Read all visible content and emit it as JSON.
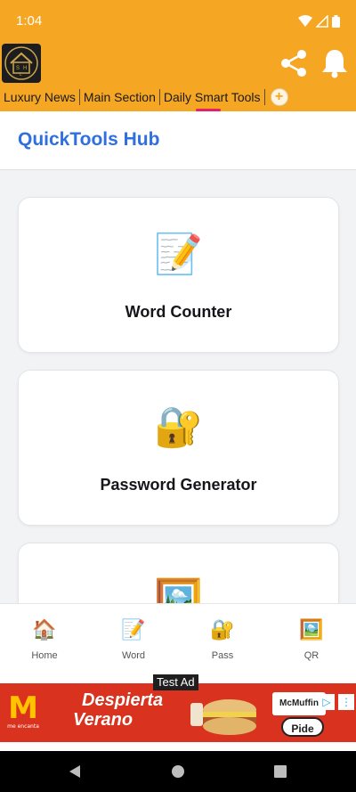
{
  "status_bar": {
    "time": "1:04"
  },
  "header": {
    "logo_icon": "house-logo-icon",
    "logo_letters": [
      "S",
      "H",
      "L"
    ],
    "tabs": [
      {
        "label": "Luxury News"
      },
      {
        "label": "Main Section"
      },
      {
        "label": "Daily Smart Tools"
      }
    ],
    "add_tab_icon": "plus-circle-icon",
    "accent_color": "#f5a623",
    "active_tab_indicator_color": "#e91e63"
  },
  "page": {
    "title": "QuickTools Hub",
    "title_color": "#2f6fdf"
  },
  "cards": [
    {
      "icon": "memo-icon",
      "emoji": "📝",
      "label": "Word Counter"
    },
    {
      "icon": "locked-with-key-icon",
      "emoji": "🔐",
      "label": "Password Generator"
    },
    {
      "icon": "framed-picture-icon",
      "emoji": "🖼️",
      "label": ""
    }
  ],
  "bottom_nav": [
    {
      "icon": "house-icon",
      "emoji": "🏠",
      "label": "Home"
    },
    {
      "icon": "memo-icon",
      "emoji": "📝",
      "label": "Word"
    },
    {
      "icon": "locked-with-key-icon",
      "emoji": "🔐",
      "label": "Pass"
    },
    {
      "icon": "framed-picture-icon",
      "emoji": "🖼️",
      "label": "QR"
    }
  ],
  "ad": {
    "label": "Test Ad",
    "logo": "M",
    "logo_caption": "me encanta",
    "headline_line1": "Despierta",
    "headline_line2": "Verano",
    "brand": "McMuffin",
    "cta": "Pide aquí"
  }
}
